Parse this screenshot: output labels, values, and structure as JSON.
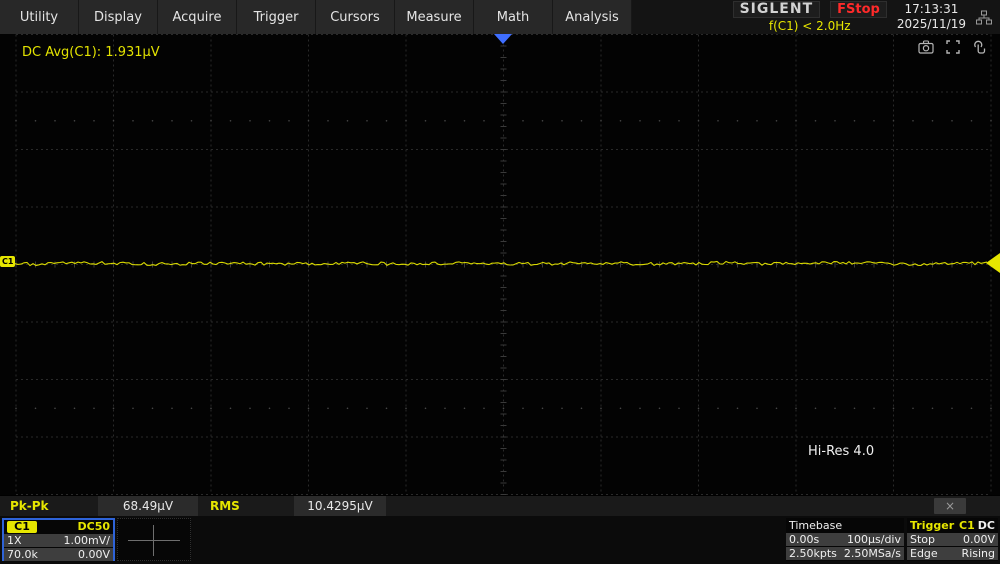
{
  "menu": {
    "items": [
      "Utility",
      "Display",
      "Acquire",
      "Trigger",
      "Cursors",
      "Measure",
      "Math",
      "Analysis"
    ]
  },
  "topbar": {
    "brand": "SIGLENT",
    "acquisition_status": "FStop",
    "time": "17:13:31",
    "date": "2025/11/19",
    "frequency_readout": "f(C1) < 2.0Hz"
  },
  "screen": {
    "measurement_readout": "DC Avg(C1): 1.931µV",
    "acquisition_mode": "Hi-Res 4.0",
    "channel_marker": "C1"
  },
  "measure_strip": {
    "measurements": [
      {
        "label": "Pk-Pk",
        "value": "68.49µV"
      },
      {
        "label": "RMS",
        "value": "10.4295µV"
      }
    ],
    "close_glyph": "×"
  },
  "channel_box": {
    "name": "C1",
    "coupling": "DC50",
    "probe_atten": "1X",
    "volts_div": "1.00mV/",
    "bandwidth": "70.0k",
    "offset": "0.00V"
  },
  "timebase_box": {
    "title": "Timebase",
    "delay": "0.00s",
    "time_div": "100µs/div",
    "mem_depth": "2.50kpts",
    "sample_rate": "2.50MSa/s"
  },
  "trigger_box": {
    "title": "Trigger",
    "source": "C1",
    "coupling": "DC",
    "status": "Stop",
    "level": "0.00V",
    "type": "Edge",
    "slope": "Rising"
  },
  "colors": {
    "accent_yellow": "#e6e600",
    "status_red": "#ff2a2a",
    "trigger_blue": "#3f6eff",
    "channel_border_blue": "#2e63d8",
    "trace": "#e6e600"
  }
}
